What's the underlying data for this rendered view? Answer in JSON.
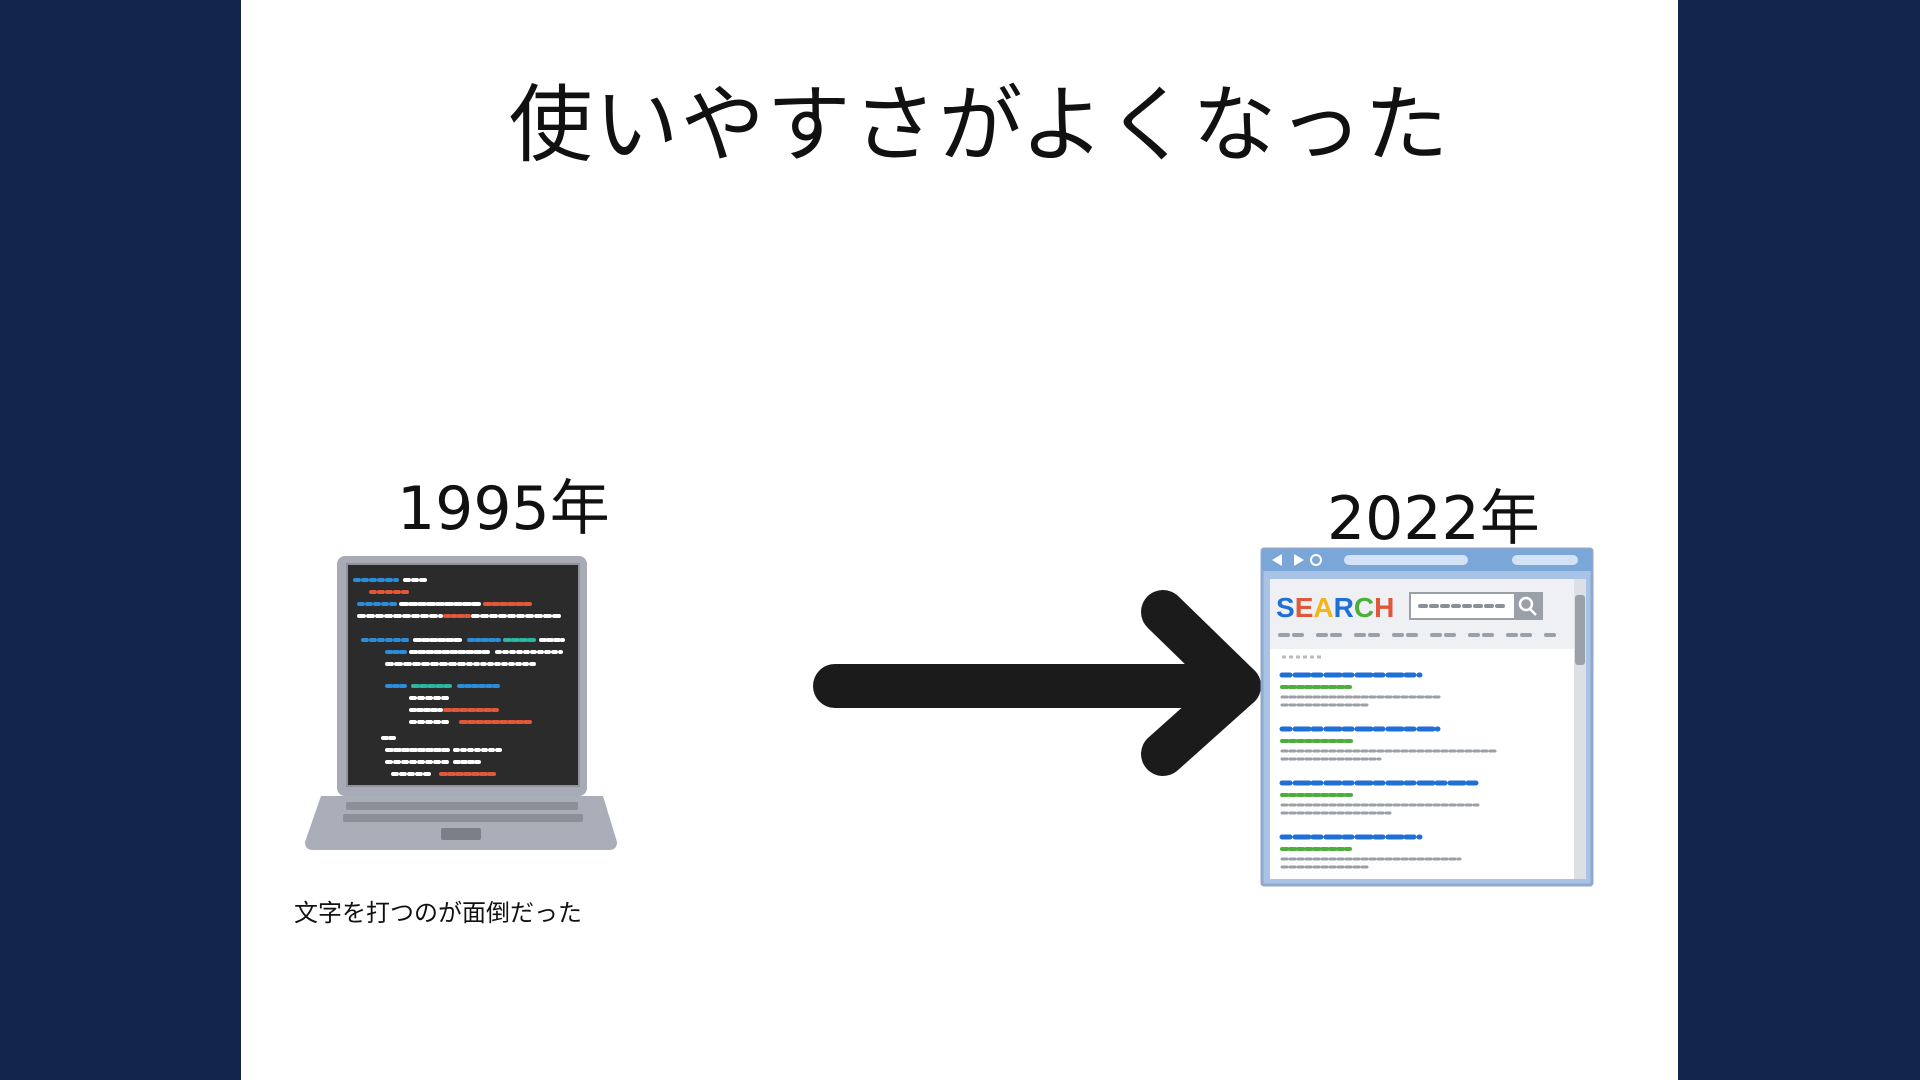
{
  "slide": {
    "title": "使いやすさがよくなった",
    "left": {
      "year": "1995年",
      "caption": "文字を打つのが面倒だった"
    },
    "right": {
      "year": "2022年",
      "search_logo": "SEARCH"
    }
  },
  "icons": {
    "laptop": "laptop-code-icon",
    "arrow": "right-arrow-icon",
    "browser": "browser-search-icon",
    "magnifier": "search-icon"
  },
  "colors": {
    "background": "#13254c",
    "slide": "#ffffff",
    "arrow": "#1b1b1b",
    "screen": "#2b2b2b",
    "code_blue": "#2b8cd8",
    "code_orange": "#e0573a",
    "code_teal": "#2cb5a0",
    "link_blue": "#1f6fd6",
    "url_green": "#4caf3c",
    "browser_frame": "#7aa6d8"
  }
}
